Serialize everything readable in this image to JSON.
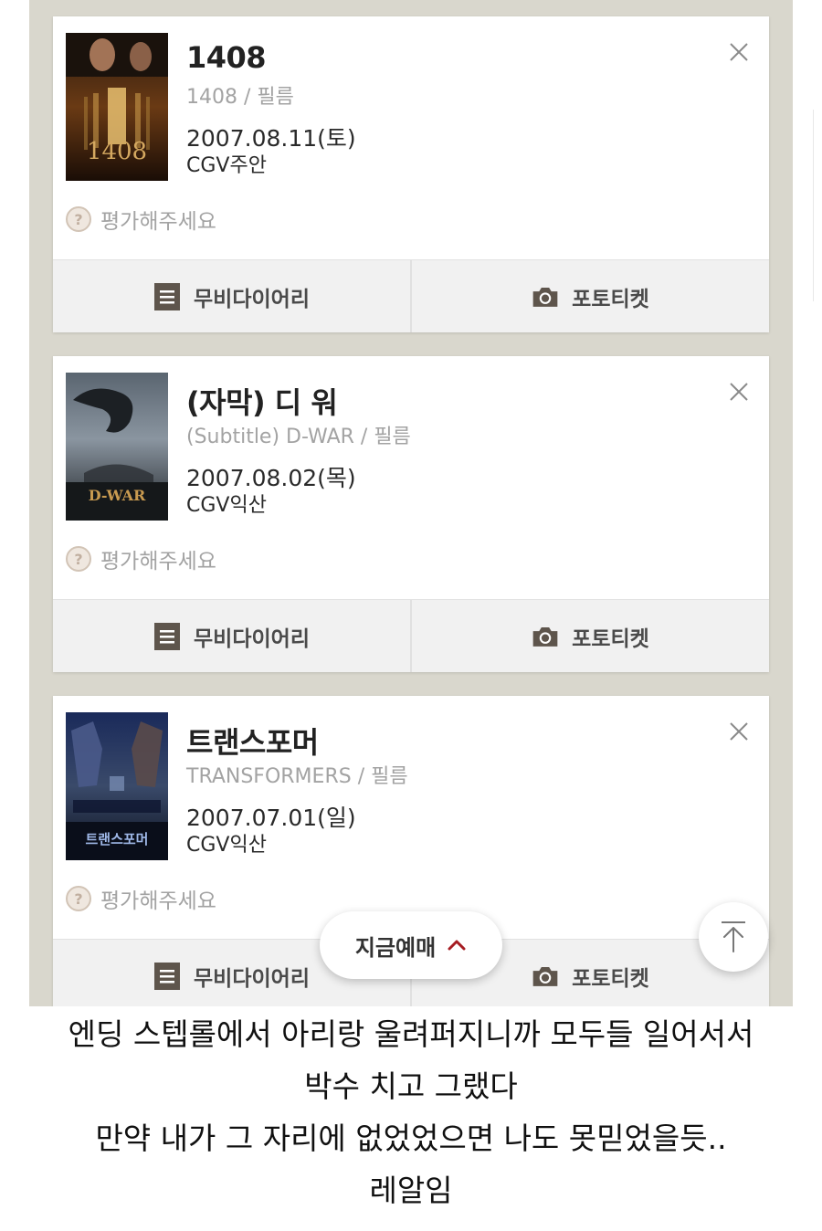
{
  "items": [
    {
      "title": "1408",
      "subtitle": "1408 / 필름",
      "date": "2007.08.11(토)",
      "theater": "CGV주안",
      "rate_label": "평가해주세요",
      "rate_icon": "?",
      "diary_label": "무비다이어리",
      "photo_label": "포토티켓",
      "poster_text": "1408"
    },
    {
      "title": "(자막) 디 워",
      "subtitle": "(Subtitle) D-WAR / 필름",
      "date": "2007.08.02(목)",
      "theater": "CGV익산",
      "rate_label": "평가해주세요",
      "rate_icon": "?",
      "diary_label": "무비다이어리",
      "photo_label": "포토티켓",
      "poster_text": "D-WAR"
    },
    {
      "title": "트랜스포머",
      "subtitle": "TRANSFORMERS / 필름",
      "date": "2007.07.01(일)",
      "theater": "CGV익산",
      "rate_label": "평가해주세요",
      "rate_icon": "?",
      "diary_label": "무비다이어리",
      "photo_label": "포토티켓",
      "poster_text": "트랜스포머"
    }
  ],
  "book_button": {
    "label": "지금예매"
  },
  "caption": {
    "line1": "엔딩 스텝롤에서 아리랑 울려퍼지니까 모두들 일어서서",
    "line2": "박수 치고 그랬다",
    "line3": "만약 내가 그 자리에 없었었으면 나도 못믿었을듯..",
    "line4": "레알임"
  },
  "colors": {
    "background": "#d9d7cd",
    "card": "#ffffff",
    "action_bar": "#f1f1f1",
    "accent": "#a61c22",
    "muted_text": "#a3a3a3",
    "icon": "#5e554c"
  },
  "icons": {
    "close": "close-icon",
    "diary": "document-list-icon",
    "photo": "camera-icon",
    "rate": "question-icon",
    "book": "chevron-up-icon",
    "top": "arrow-up-icon"
  }
}
